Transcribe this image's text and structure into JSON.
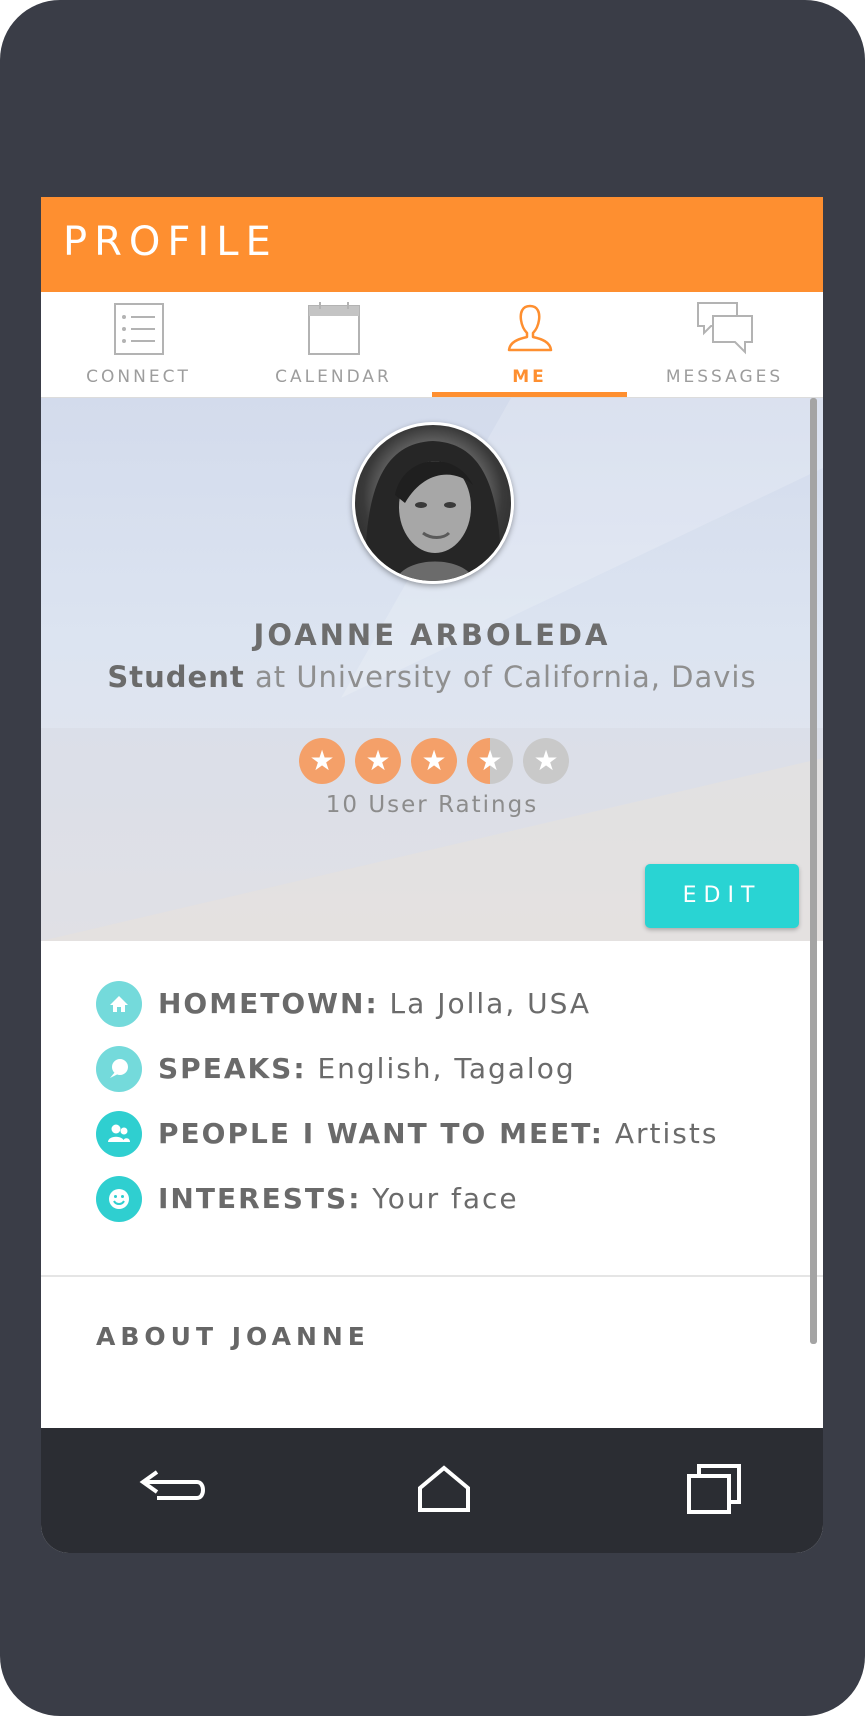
{
  "appbar": {
    "title": "PROFILE"
  },
  "tabs": [
    {
      "label": "CONNECT",
      "icon": "list-icon",
      "active": false
    },
    {
      "label": "CALENDAR",
      "icon": "calendar-icon",
      "active": false
    },
    {
      "label": "ME",
      "icon": "person-icon",
      "active": true
    },
    {
      "label": "MESSAGES",
      "icon": "chat-bubbles-icon",
      "active": false
    }
  ],
  "profile": {
    "name": "JOANNE ARBOLEDA",
    "role": "Student",
    "org_text": " at University of California, Davis",
    "rating": 3.5,
    "rating_max": 5,
    "ratings_count_label": "10 User Ratings",
    "edit_label": "EDIT"
  },
  "details": [
    {
      "key": "HOMETOWN:",
      "value": " La Jolla, USA",
      "icon": "home-icon"
    },
    {
      "key": "SPEAKS:",
      "value": " English, Tagalog",
      "icon": "speech-bubble-icon"
    },
    {
      "key": "PEOPLE I WANT TO MEET:",
      "value": " Artists",
      "icon": "people-icon"
    },
    {
      "key": "INTERESTS:",
      "value": " Your face",
      "icon": "smiley-icon"
    }
  ],
  "about": {
    "title": "ABOUT JOANNE"
  },
  "navbar": {
    "back_icon": "back-icon",
    "home_icon": "home-outline-icon",
    "recents_icon": "recents-icon"
  },
  "colors": {
    "accent": "#fe8f30",
    "teal": "#29d4d3",
    "star_off": "#c9c9c9",
    "device": "#3a3d47"
  }
}
